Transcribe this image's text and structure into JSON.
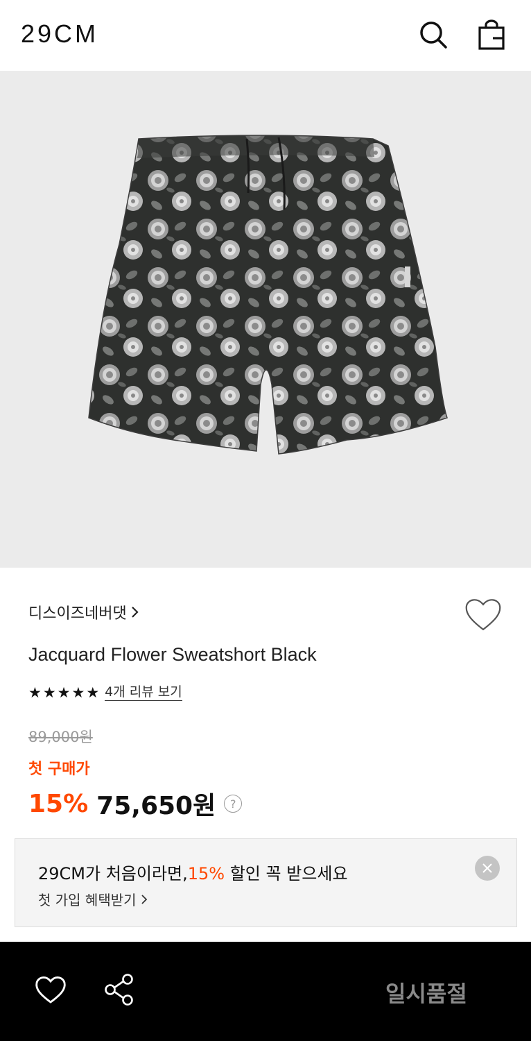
{
  "header": {
    "logo": "29CM",
    "icons": [
      "search-icon",
      "shopping-bag-icon"
    ]
  },
  "product": {
    "brand": "디스이즈네버댓",
    "name": "Jacquard Flower Sweatshort Black",
    "rating": {
      "stars": 5,
      "review_link": "4개 리뷰 보기"
    },
    "original_price": "89,000원",
    "first_purchase_label": "첫 구매가",
    "discount": "15%",
    "price": "75,650원"
  },
  "promo": {
    "title_prefix": "29CM가 처음이라면,",
    "title_accent": "15%",
    "title_suffix": " 할인 꼭 받으세요",
    "subtitle": "첫 가입 혜택받기"
  },
  "bottom_bar": {
    "status": "일시품절"
  },
  "colors": {
    "accent": "#ff4800",
    "hero_background": "#ebebeb",
    "bottom_bar": "#000000"
  }
}
